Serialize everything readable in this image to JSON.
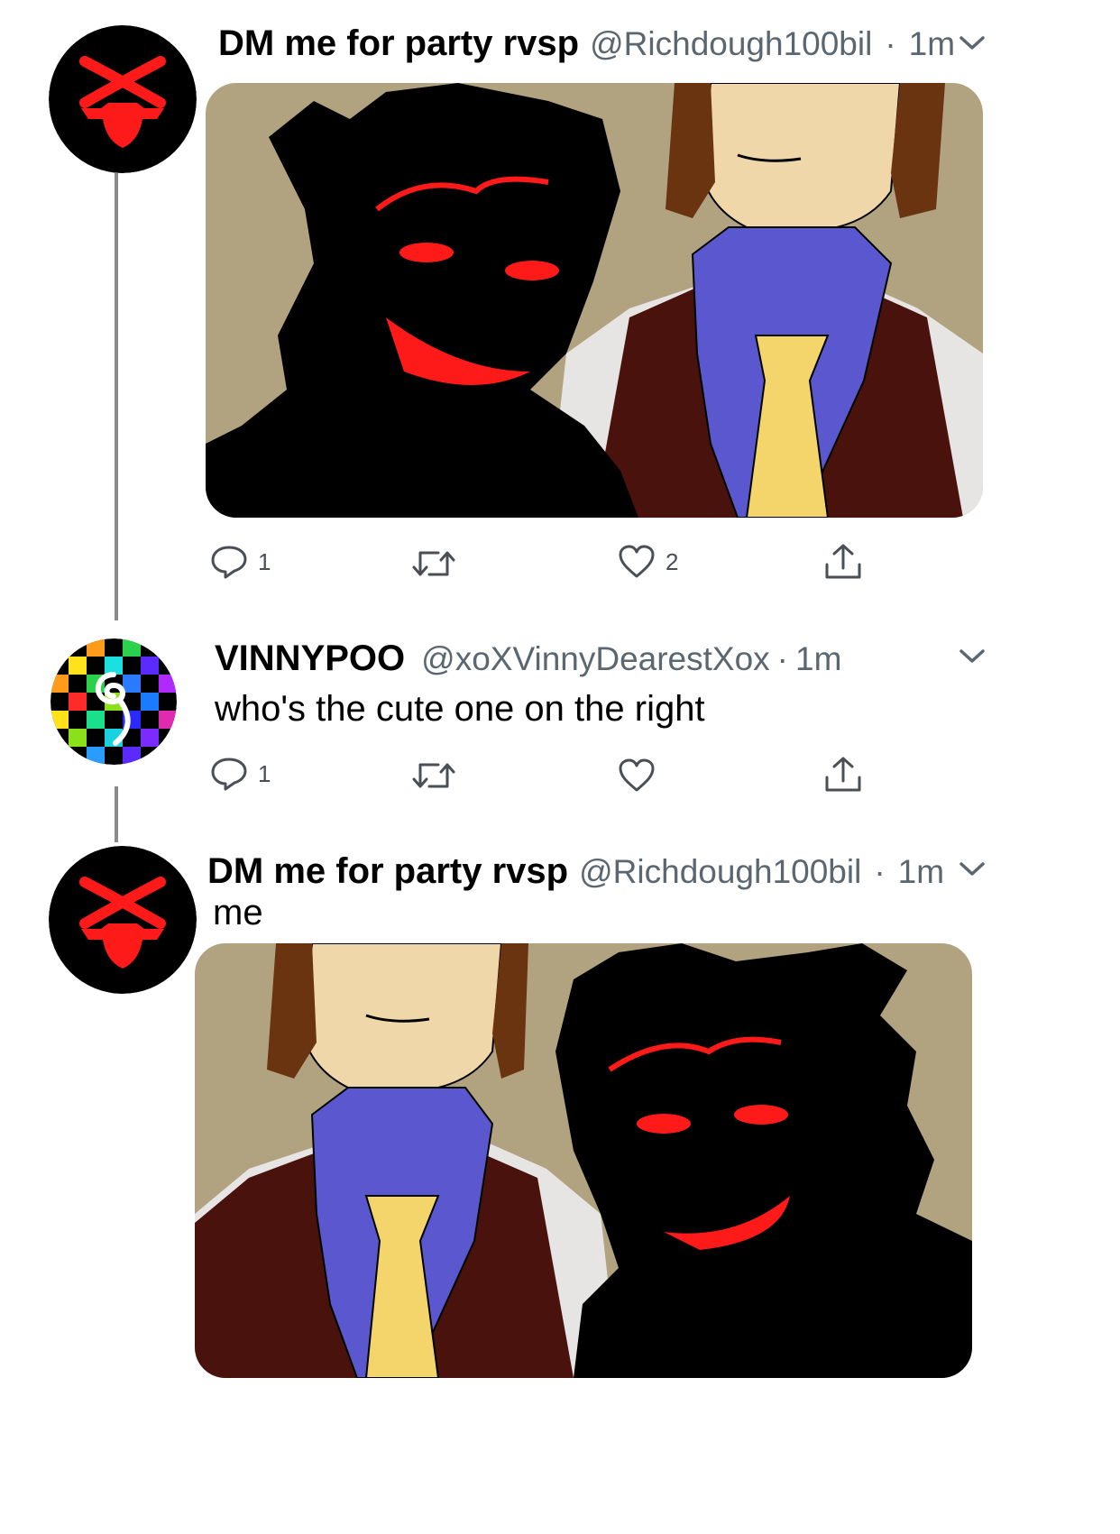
{
  "tweets": [
    {
      "display_name": "DM me for party rvsp",
      "handle": "@Richdough100bil",
      "separator": "·",
      "time": "1m",
      "replies": "1",
      "likes": "2"
    },
    {
      "display_name": "VINNYPOO",
      "handle": "@xoXVinnyDearestXox",
      "separator": "·",
      "time": "1m",
      "text": "who's the cute one on the right",
      "replies": "1"
    },
    {
      "display_name": "DM me for party rvsp",
      "handle": "@Richdough100bil",
      "separator": "·",
      "time": "1m",
      "text": "me"
    }
  ],
  "icons": {
    "reply": "reply-icon",
    "retweet": "retweet-icon",
    "like": "heart-icon",
    "share": "share-icon",
    "menu": "chevron-down-icon"
  },
  "colors": {
    "avatar_red": "#ff1a1a",
    "wall_tan": "#b1a37f",
    "shirt_blue": "#5b58cf",
    "tie_yellow": "#f3d56b",
    "vest_brown": "#4a120c",
    "hair_brown": "#6b3410",
    "skin": "#f0d7aa",
    "secondary_text": "#5b6770"
  }
}
